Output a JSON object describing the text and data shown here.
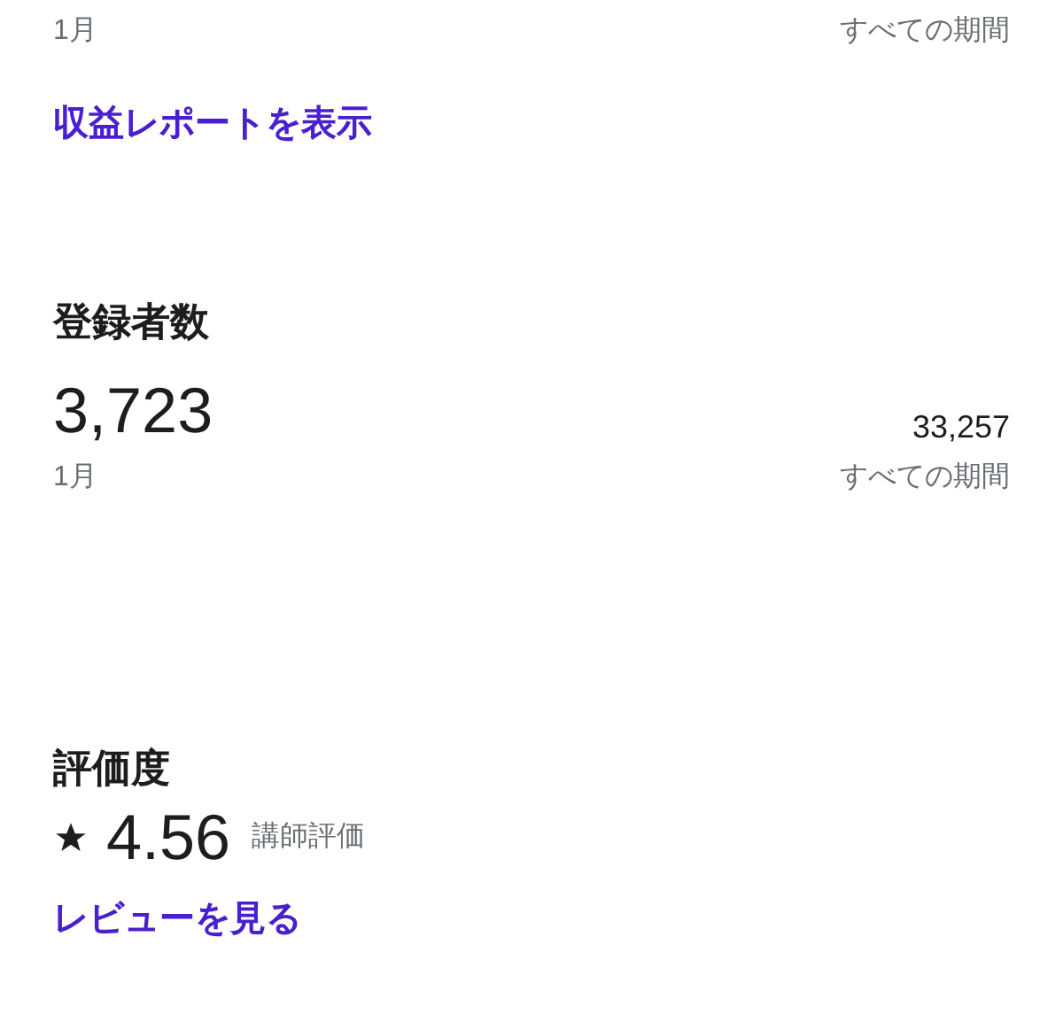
{
  "revenue": {
    "period_label": "1月",
    "total_label": "すべての期間",
    "link": "収益レポートを表示"
  },
  "subscribers": {
    "title": "登録者数",
    "value": "3,723",
    "period_label": "1月",
    "total": "33,257",
    "total_label": "すべての期間"
  },
  "rating": {
    "title": "評価度",
    "value": "4.56",
    "caption": "講師評価",
    "link": "レビューを見る"
  }
}
